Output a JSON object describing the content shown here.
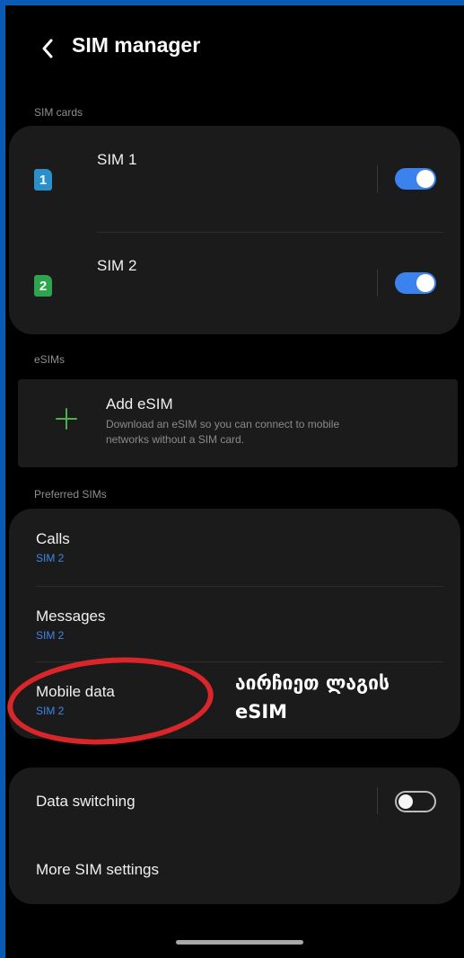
{
  "header": {
    "title": "SIM manager"
  },
  "sections": {
    "sim_cards": "SIM cards",
    "esims": "eSIMs",
    "preferred": "Preferred SIMs"
  },
  "sims": [
    {
      "number": "1",
      "name": "SIM 1",
      "color": "#2b8fc9",
      "enabled": true
    },
    {
      "number": "2",
      "name": "SIM 2",
      "color": "#2ea44f",
      "enabled": true
    }
  ],
  "add_esim": {
    "title": "Add eSIM",
    "description_line1": "Download an eSIM so you can connect to mobile",
    "description_line2": "networks without a SIM card."
  },
  "preferred": [
    {
      "title": "Calls",
      "value": "SIM 2"
    },
    {
      "title": "Messages",
      "value": "SIM 2"
    },
    {
      "title": "Mobile data",
      "value": "SIM 2"
    }
  ],
  "more": {
    "data_switching": "Data switching",
    "data_switching_enabled": false,
    "more_settings": "More SIM settings"
  },
  "annotation": {
    "line1": "აირჩიეთ ლაგის",
    "line2": "eSIM"
  },
  "colors": {
    "accent": "#3c82ee",
    "frame": "#0a5bb5",
    "highlight": "#d8262b"
  }
}
